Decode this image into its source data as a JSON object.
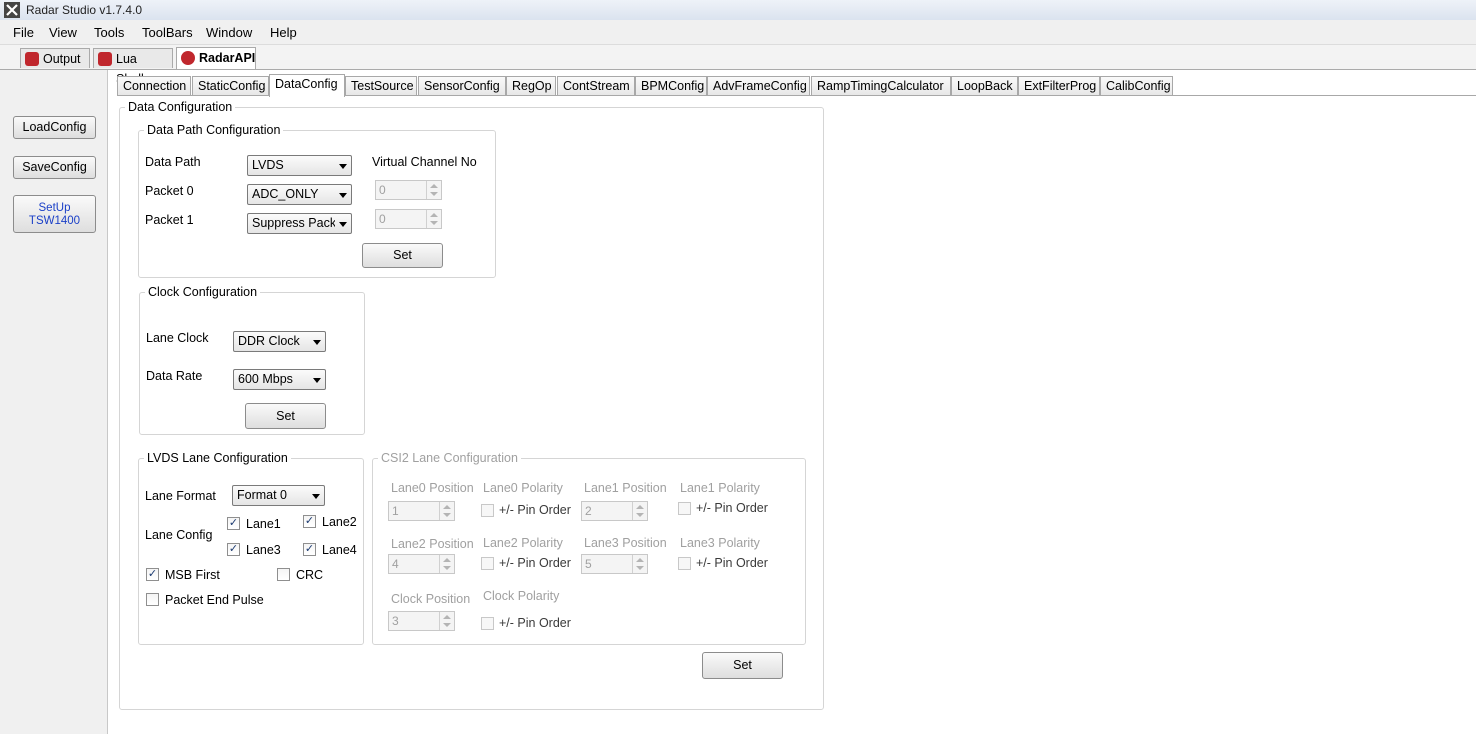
{
  "window": {
    "title": "Radar Studio v1.7.4.0"
  },
  "menu": [
    "File",
    "View",
    "Tools",
    "ToolBars",
    "Window",
    "Help"
  ],
  "doc_tabs": [
    {
      "label": "Output",
      "icon": "output-icon"
    },
    {
      "label": "Lua Shell",
      "icon": "lua-shell-icon"
    },
    {
      "label": "RadarAPI",
      "icon": "radar-api-icon",
      "active": true
    }
  ],
  "sidebar": {
    "load": "LoadConfig",
    "save": "SaveConfig",
    "setup_line1": "SetUp",
    "setup_line2": "TSW1400",
    "setup_color": "#1a3fc7"
  },
  "tabs": [
    "Connection",
    "StaticConfig",
    "DataConfig",
    "TestSource",
    "SensorConfig",
    "RegOp",
    "ContStream",
    "BPMConfig",
    "AdvFrameConfig",
    "RampTimingCalculator",
    "LoopBack",
    "ExtFilterProg",
    "CalibConfig"
  ],
  "active_tab": "DataConfig",
  "data_config": {
    "title": "Data Configuration",
    "data_path": {
      "title": "Data Path Configuration",
      "data_path_label": "Data Path",
      "data_path_value": "LVDS",
      "virtual_channel_label": "Virtual Channel No",
      "packet0_label": "Packet 0",
      "packet0_value": "ADC_ONLY",
      "packet0_vc": "0",
      "packet1_label": "Packet 1",
      "packet1_value": "Suppress Packet",
      "packet1_vc": "0",
      "set_label": "Set"
    },
    "clock": {
      "title": "Clock Configuration",
      "lane_clock_label": "Lane Clock",
      "lane_clock_value": "DDR Clock",
      "data_rate_label": "Data Rate",
      "data_rate_value": "600 Mbps",
      "set_label": "Set"
    },
    "lvds": {
      "title": "LVDS Lane Configuration",
      "lane_format_label": "Lane Format",
      "lane_format_value": "Format 0",
      "lane_config_label": "Lane Config",
      "lane1": "Lane1",
      "lane1_checked": true,
      "lane2": "Lane2",
      "lane2_checked": true,
      "lane3": "Lane3",
      "lane3_checked": true,
      "lane4": "Lane4",
      "lane4_checked": true,
      "msb_first": "MSB First",
      "msb_first_checked": true,
      "crc": "CRC",
      "crc_checked": false,
      "packet_end_pulse": "Packet End Pulse",
      "packet_end_pulse_checked": false
    },
    "csi2": {
      "title": "CSI2 Lane Configuration",
      "lane0_position": "Lane0 Position",
      "lane0_value": "1",
      "lane0_polarity": "Lane0 Polarity",
      "lane1_position": "Lane1 Position",
      "lane1_value": "2",
      "lane1_polarity": "Lane1 Polarity",
      "lane2_position": "Lane2 Position",
      "lane2_value": "4",
      "lane2_polarity": "Lane2 Polarity",
      "lane3_position": "Lane3 Position",
      "lane3_value": "5",
      "lane3_polarity": "Lane3 Polarity",
      "clock_position": "Clock Position",
      "clock_value": "3",
      "clock_polarity": "Clock Polarity",
      "pin_order": "+/- Pin Order"
    },
    "set_label": "Set"
  }
}
